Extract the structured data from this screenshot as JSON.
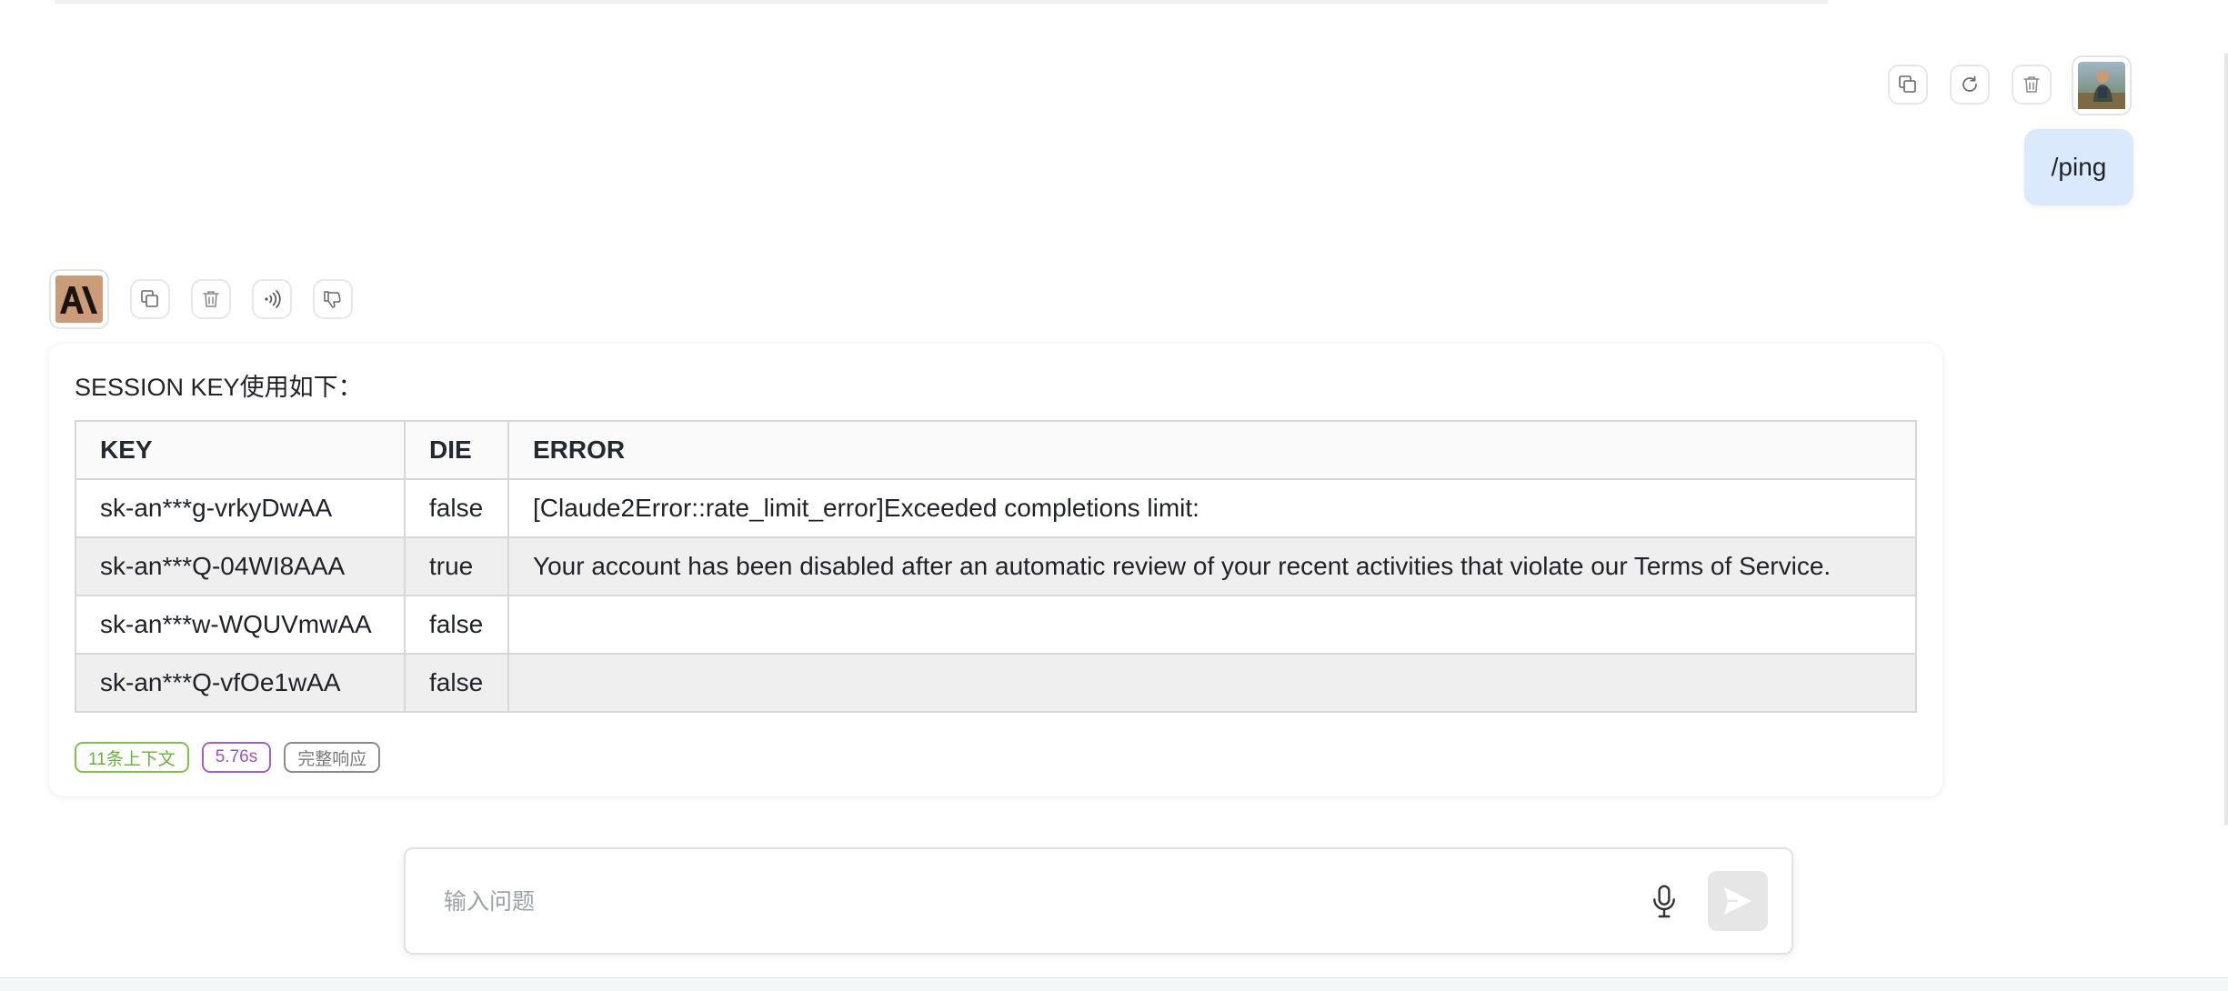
{
  "user_message": {
    "text": "/ping",
    "actions": [
      "copy-icon",
      "refresh-icon",
      "trash-icon"
    ],
    "avatar": "user-photo"
  },
  "bot_message": {
    "avatar": "anthropic-logo",
    "actions": [
      "copy-icon",
      "trash-icon",
      "speaker-icon",
      "thumbs-down-icon"
    ],
    "title": "SESSION KEY使用如下：",
    "table": {
      "headers": [
        "KEY",
        "DIE",
        "ERROR"
      ],
      "rows": [
        [
          "sk-an***g-vrkyDwAA",
          "false",
          "[Claude2Error::rate_limit_error]Exceeded completions limit:"
        ],
        [
          "sk-an***Q-04WI8AAA",
          "true",
          "Your account has been disabled after an automatic review of your recent activities that violate our Terms of Service."
        ],
        [
          "sk-an***w-WQUVmwAA",
          "false",
          ""
        ],
        [
          "sk-an***Q-vfOe1wAA",
          "false",
          ""
        ]
      ]
    },
    "tags": {
      "context": "11条上下文",
      "time": "5.76s",
      "full": "完整响应"
    }
  },
  "composer": {
    "placeholder": "输入问题",
    "value": ""
  },
  "colors": {
    "user_bubble": "#dbe9fd",
    "tag_green": "#7cc24a",
    "tag_purple": "#a35fc8",
    "tag_gray": "#8a8a8a",
    "alt_row": "#efefef"
  }
}
